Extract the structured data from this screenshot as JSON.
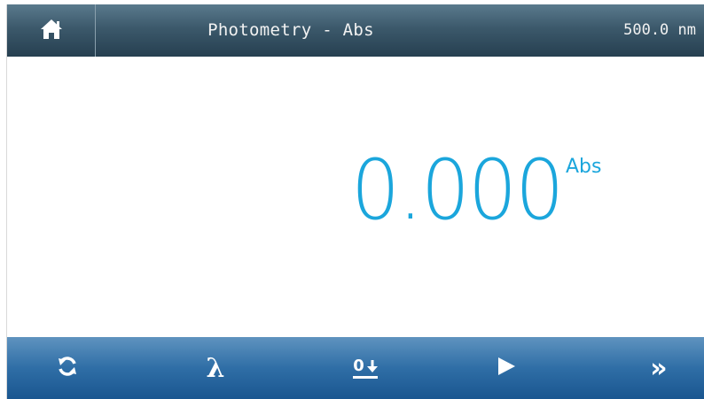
{
  "header": {
    "home_icon": "home-icon",
    "title": "Photometry - Abs",
    "wavelength": "500.0 nm"
  },
  "main": {
    "reading": "0.000",
    "unit": "Abs"
  },
  "toolbar": {
    "refresh_icon": "refresh-icon",
    "wavelength_icon": "lambda-icon",
    "wavelength_glyph": "λ",
    "zero_icon": "zero-icon",
    "zero_label": "0",
    "play_icon": "play-icon",
    "next_icon": "double-chevron-right-icon",
    "next_glyph": "»"
  },
  "colors": {
    "header_bg": "#3c596b",
    "footer_bg": "#2f6ea6",
    "reading": "#1ba6dc",
    "header_text": "#f2f2f2"
  }
}
